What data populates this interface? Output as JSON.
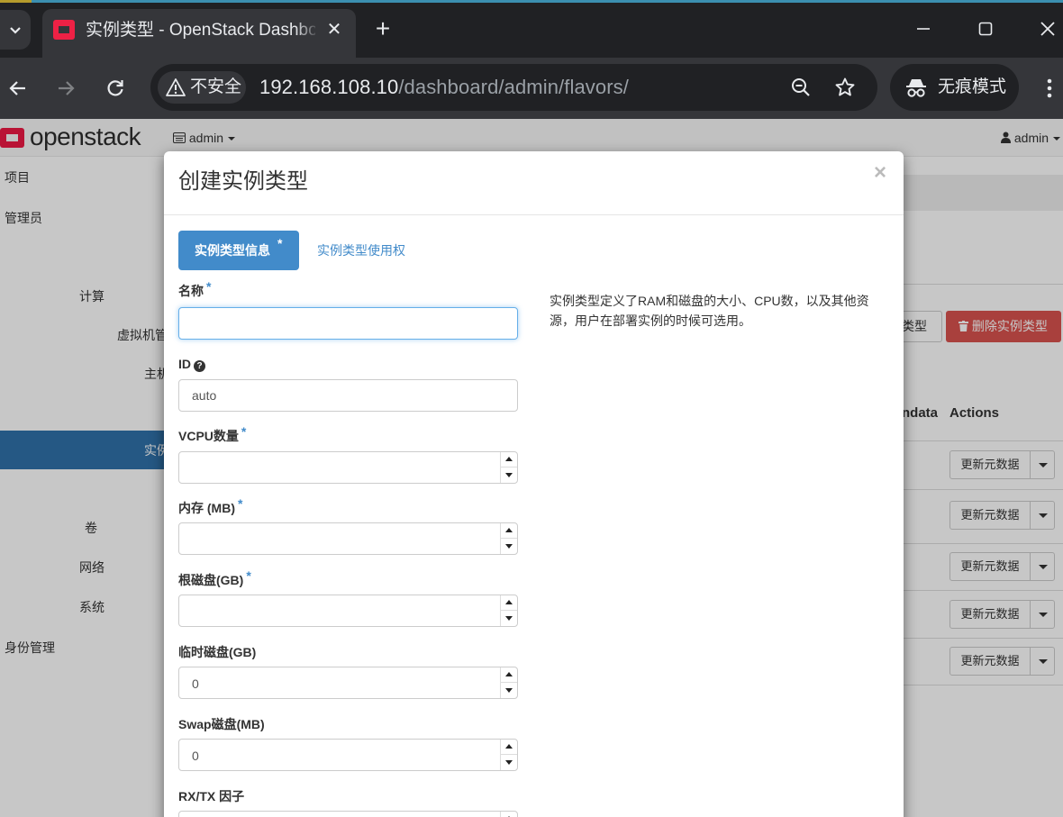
{
  "browser": {
    "tab_title": "实例类型 - OpenStack Dashboard",
    "tab_close": "✕",
    "new_tab": "+",
    "security_label": "不安全",
    "url_host": "192.168.108.10",
    "url_path": "/dashboard/admin/flavors/",
    "incognito_label": "无痕模式"
  },
  "header": {
    "logo_text": "openstack",
    "project_selector": "admin",
    "user_menu": "admin"
  },
  "sidebar": {
    "project": "项目",
    "admin": "管理员",
    "compute": "计算",
    "hypervisors": "虚拟机管",
    "host_aggregates": "主机",
    "instances": "实例",
    "volumes": "卷",
    "network": "网络",
    "system": "系统",
    "identity": "身份管理"
  },
  "background": {
    "create_button_partial": "类型",
    "delete_button": "删除实例类型",
    "col_metadata_partial": "ndata",
    "col_actions": "Actions",
    "row_action_label": "更新元数据",
    "rows": [
      {
        "action": "更新元数据"
      },
      {
        "action": "更新元数据"
      },
      {
        "action": "更新元数据"
      },
      {
        "action": "更新元数据"
      },
      {
        "action": "更新元数据"
      }
    ]
  },
  "modal": {
    "title": "创建实例类型",
    "close": "×",
    "tab_info": "实例类型信息",
    "tab_access": "实例类型使用权",
    "required_mark": "*",
    "description": "实例类型定义了RAM和磁盘的大小、CPU数，以及其他资源，用户在部署实例的时候可选用。",
    "fields": {
      "name": {
        "label": "名称",
        "value": ""
      },
      "id": {
        "label": "ID",
        "value": "auto"
      },
      "vcpu": {
        "label": "VCPU数量",
        "value": ""
      },
      "ram": {
        "label": "内存 (MB)",
        "value": ""
      },
      "root_disk": {
        "label": "根磁盘(GB)",
        "value": ""
      },
      "ephemeral_disk": {
        "label": "临时磁盘(GB)",
        "value": "0"
      },
      "swap_disk": {
        "label": "Swap磁盘(MB)",
        "value": "0"
      },
      "rxtx_factor": {
        "label": "RX/TX 因子",
        "value": ""
      }
    }
  },
  "colors": {
    "primary": "#428bca",
    "danger": "#d9534f",
    "sidebar_active": "#3071a9",
    "openstack_red": "#ed1944"
  }
}
